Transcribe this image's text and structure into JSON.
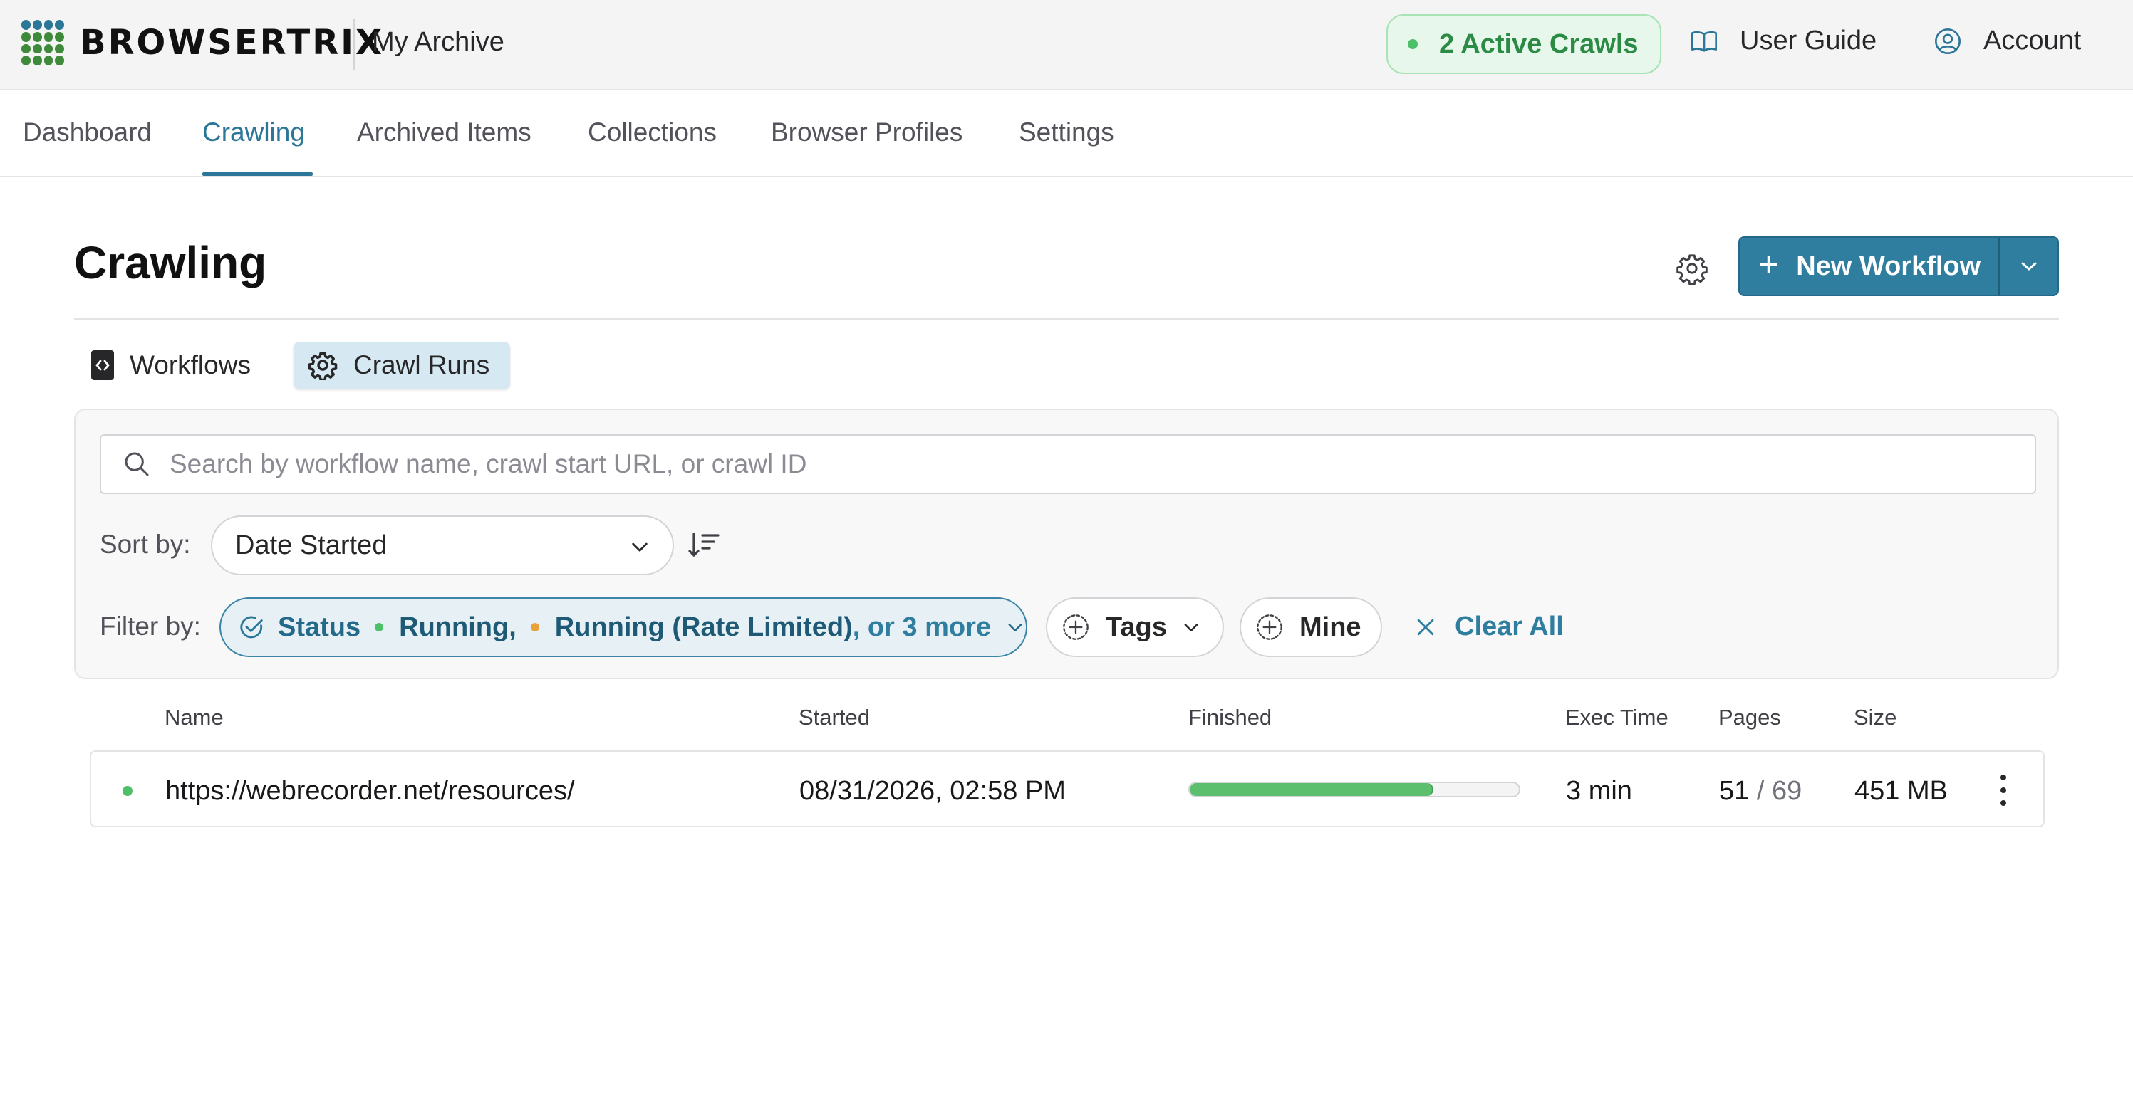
{
  "header": {
    "brand": "BROWSERTRIX",
    "org_name": "My Archive",
    "active_crawls": "2 Active Crawls",
    "user_guide": "User Guide",
    "account": "Account"
  },
  "nav": {
    "tabs": [
      {
        "label": "Dashboard",
        "active": false
      },
      {
        "label": "Crawling",
        "active": true
      },
      {
        "label": "Archived Items",
        "active": false
      },
      {
        "label": "Collections",
        "active": false
      },
      {
        "label": "Browser Profiles",
        "active": false
      },
      {
        "label": "Settings",
        "active": false
      }
    ]
  },
  "page": {
    "title": "Crawling",
    "new_workflow": "New Workflow"
  },
  "subtabs": [
    {
      "label": "Workflows",
      "icon": "code-file-icon",
      "active": false
    },
    {
      "label": "Crawl Runs",
      "icon": "gear-icon",
      "active": true
    }
  ],
  "filters": {
    "search_placeholder": "Search by workflow name, crawl start URL, or crawl ID",
    "sort_label": "Sort by:",
    "sort_value": "Date Started",
    "filter_label": "Filter by:",
    "status_label": "Status",
    "status_values": [
      "Running,",
      "Running (Rate Limited)"
    ],
    "status_more": ", or 3 more",
    "tags_label": "Tags",
    "mine_label": "Mine",
    "clear_all": "Clear All"
  },
  "table": {
    "columns": [
      "Name",
      "Started",
      "Finished",
      "Exec Time",
      "Pages",
      "Size"
    ],
    "rows": [
      {
        "name": "https://webrecorder.net/resources/",
        "started": "08/31/2026, 02:58 PM",
        "progress_fraction": 0.74,
        "exec_time": "3 min",
        "pages_done": "51",
        "pages_sep": "/",
        "pages_total": "69",
        "size": "451 MB"
      }
    ]
  },
  "colors": {
    "accent": "#2c7698",
    "running": "#4ec069",
    "rate_limited": "#e9a23b",
    "logo_green": "#3f8a3a",
    "logo_teal": "#2c7698"
  }
}
